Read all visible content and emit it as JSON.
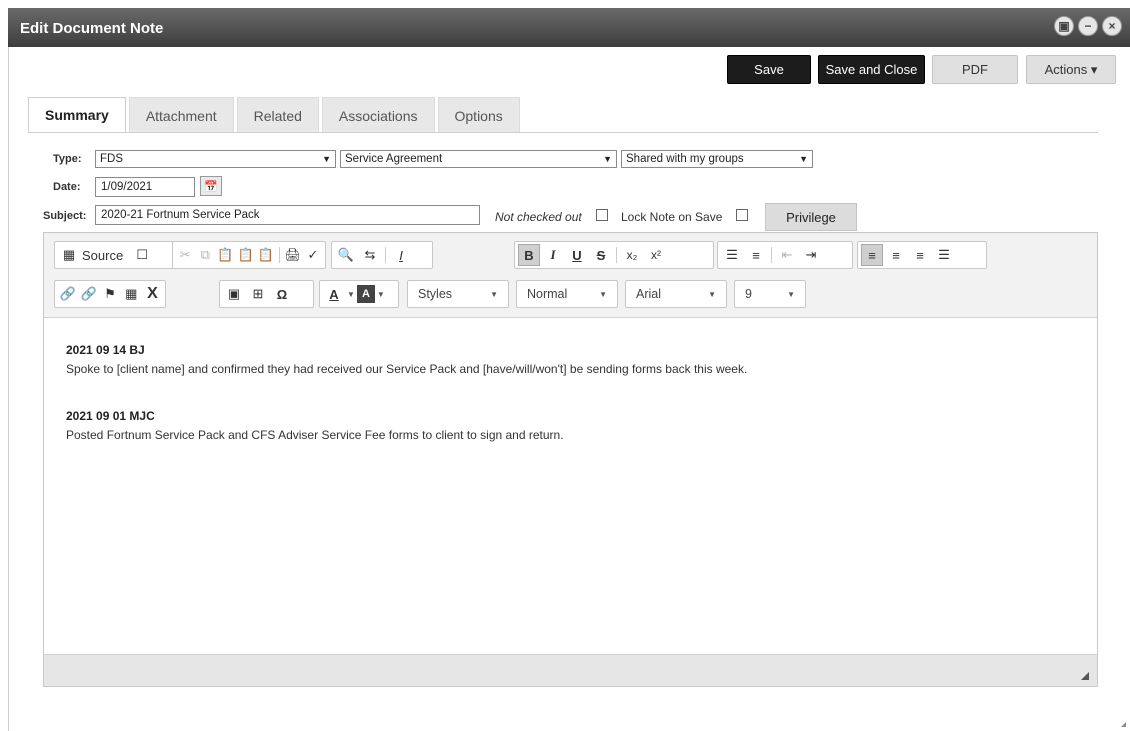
{
  "window": {
    "title": "Edit Document Note"
  },
  "actions": {
    "save": "Save",
    "save_close": "Save and Close",
    "pdf": "PDF",
    "actions": "Actions ▾"
  },
  "tabs": [
    "Summary",
    "Attachment",
    "Related",
    "Associations",
    "Options"
  ],
  "form": {
    "type_label": "Type:",
    "type_value": "FDS",
    "subtype_value": "Service Agreement",
    "sharing_value": "Shared with my groups",
    "date_label": "Date:",
    "date_value": "1/09/2021",
    "subject_label": "Subject:",
    "subject_value": "2020-21 Fortnum Service Pack",
    "checked_out_text": "Not checked out",
    "lock_label": "Lock Note on Save",
    "privilege_label": "Privilege"
  },
  "toolbar": {
    "source_label": "Source",
    "styles": "Styles",
    "format": "Normal",
    "font": "Arial",
    "size": "9"
  },
  "entries": [
    {
      "date": "2021 09 14 BJ",
      "text": "Spoke to [client name] and confirmed they had received our Service Pack and [have/will/won't] be sending forms back this week."
    },
    {
      "date": "2021 09 01 MJC",
      "text": "Posted Fortnum Service Pack and CFS Adviser Service Fee forms to client to sign and return."
    }
  ]
}
